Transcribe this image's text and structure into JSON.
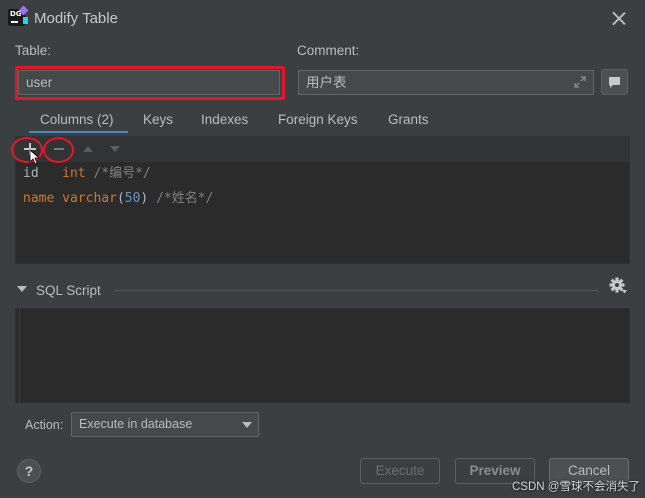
{
  "window": {
    "title": "Modify Table"
  },
  "table_field": {
    "label": "Table:",
    "value": "user"
  },
  "comment_field": {
    "label": "Comment:",
    "value": "用户表"
  },
  "tabs": [
    {
      "label": "Columns (2)",
      "active": true
    },
    {
      "label": "Keys"
    },
    {
      "label": "Indexes"
    },
    {
      "label": "Foreign Keys"
    },
    {
      "label": "Grants"
    }
  ],
  "columns_toolbar": {
    "add": "add-icon",
    "remove": "remove-icon",
    "move_up": "arrow-up-icon",
    "move_down": "arrow-down-icon"
  },
  "columns": [
    {
      "name": "id",
      "type": "int",
      "comment": "/*编号*/"
    },
    {
      "name": "name",
      "type_base": "varchar",
      "type_open": "(",
      "type_size": "50",
      "type_close": ")",
      "comment": "/*姓名*/"
    }
  ],
  "sql_section": {
    "label": "SQL Script",
    "expanded": true
  },
  "action": {
    "label": "Action:",
    "selected": "Execute in database"
  },
  "buttons": {
    "execute": "Execute",
    "preview": "Preview",
    "cancel": "Cancel"
  },
  "watermark": "CSDN @雪球不会消失了",
  "colors": {
    "annotation_red": "#e0192a",
    "keyword_orange": "#cc7832",
    "number_blue": "#6897bb",
    "comment_gray": "#808080"
  }
}
